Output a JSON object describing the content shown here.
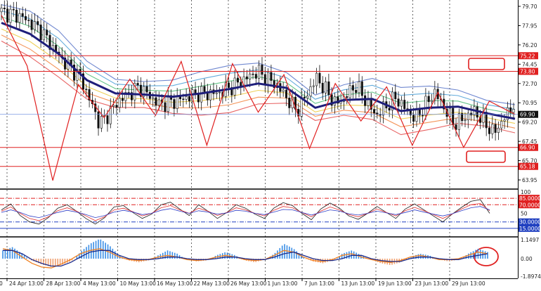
{
  "chart_data": [
    {
      "type": "candlestick",
      "panel": "price",
      "price_ticks": [
        "79.70",
        "77.95",
        "76.20",
        "74.45",
        "72.70",
        "70.95",
        "69.20",
        "67.45",
        "65.70",
        "63.95"
      ],
      "x_labels": [
        "24 Apr 13:00",
        "28 Apr 13:00",
        "4 May 13:00",
        "10 May 13:00",
        "16 May 13:00",
        "22 May 13:00",
        "26 May 13:00",
        "1 Jun 13:00",
        "7 Jun 13:00",
        "13 Jun 13:00",
        "19 Jun 13:00",
        "23 Jun 13:00",
        "29 Jun 13:00"
      ],
      "x_first_label_fragment": "0",
      "current_price": "69.90",
      "current_price_value": 69.9,
      "horizontal_levels": [
        {
          "label": "75.22",
          "value": 75.22,
          "color": "#e02020"
        },
        {
          "label": "73.80",
          "value": 73.8,
          "color": "#e02020"
        },
        {
          "label": "66.90",
          "value": 66.9,
          "color": "#e02020"
        },
        {
          "label": "65.18",
          "value": 65.18,
          "color": "#e02020"
        }
      ],
      "zigzag_points": [
        78.9,
        74.3,
        63.9,
        72.6,
        69.6,
        73.1,
        69.8,
        74.7,
        67.1,
        74.5,
        70.1,
        73.5,
        66.8,
        72.7,
        69.3,
        72.4,
        67.1,
        71.9,
        66.9,
        71.1,
        69.9
      ],
      "moving_average": [
        78.2,
        77.2,
        75.4,
        73.0,
        71.8,
        71.7,
        71.5,
        71.8,
        72.2,
        72.7,
        72.3,
        70.5,
        71.2,
        71.3,
        70.2,
        70.5,
        70.6,
        70.0,
        69.5
      ],
      "price_path": [
        79.2,
        78.8,
        77.5,
        75.0,
        73.3,
        69.0,
        71.2,
        72.4,
        70.8,
        71.2,
        71.8,
        71.8,
        72.7,
        73.8,
        72.5,
        70.2,
        73.2,
        70.8,
        72.5,
        69.8,
        71.4,
        69.5,
        71.9,
        69.0,
        70.2,
        68.2,
        70.8
      ]
    },
    {
      "type": "line",
      "panel": "oscillator",
      "levels": [
        {
          "label": "85.0000",
          "value": 85,
          "color": "#e02020",
          "style": "dashdot"
        },
        {
          "label": "70.0000",
          "value": 70,
          "color": "#e02020",
          "style": "dashdot"
        },
        {
          "label": "30.0000",
          "value": 30,
          "color": "#2040c0",
          "style": "dashdot"
        },
        {
          "label": "15.0000",
          "value": 15,
          "color": "#2040c0",
          "style": "solid"
        }
      ],
      "tick_labels": [
        "100",
        "50"
      ],
      "series": [
        {
          "values": [
            58,
            72,
            45,
            30,
            25,
            40,
            62,
            70,
            55,
            38,
            25,
            40,
            65,
            68,
            52,
            38,
            48,
            70,
            76,
            60,
            45,
            70,
            55,
            38,
            52,
            70,
            62,
            48,
            38,
            62,
            75,
            68,
            50,
            35,
            60,
            74,
            62,
            44,
            36,
            50,
            66,
            52,
            38,
            60,
            72,
            58,
            44,
            30,
            48,
            64,
            78,
            82,
            50
          ],
          "color": "#1a1a1a"
        },
        {
          "values": [
            55,
            65,
            50,
            38,
            33,
            42,
            56,
            63,
            55,
            44,
            33,
            42,
            58,
            62,
            54,
            44,
            50,
            63,
            68,
            58,
            50,
            62,
            55,
            45,
            52,
            63,
            58,
            50,
            44,
            57,
            66,
            63,
            52,
            42,
            55,
            65,
            58,
            47,
            42,
            50,
            60,
            52,
            44,
            56,
            64,
            56,
            47,
            38,
            48,
            60,
            70,
            73,
            56
          ],
          "color": "#e03030"
        },
        {
          "values": [
            52,
            58,
            52,
            44,
            40,
            46,
            52,
            57,
            53,
            47,
            40,
            45,
            53,
            57,
            53,
            47,
            50,
            57,
            61,
            55,
            50,
            56,
            53,
            48,
            51,
            57,
            55,
            50,
            47,
            53,
            59,
            58,
            52,
            46,
            52,
            58,
            55,
            49,
            46,
            50,
            55,
            51,
            47,
            52,
            58,
            53,
            48,
            44,
            49,
            56,
            63,
            66,
            58
          ],
          "color": "#3040c8"
        }
      ]
    },
    {
      "type": "bar",
      "panel": "macd",
      "tick_labels": [
        "1.1497",
        "0.00",
        "-1.8974"
      ],
      "histogram": [
        0.5,
        0.7,
        0.3,
        -0.2,
        -0.6,
        -0.9,
        -0.7,
        -0.3,
        0.4,
        0.9,
        1.2,
        0.8,
        0.2,
        -0.2,
        -0.4,
        -0.2,
        0.2,
        0.5,
        0.3,
        -0.1,
        -0.3,
        -0.2,
        0.2,
        0.4,
        0.2,
        -0.2,
        -0.4,
        -0.1,
        0.3,
        0.9,
        0.6,
        0.1,
        -0.3,
        -0.5,
        -0.2,
        0.3,
        0.5,
        0.2,
        -0.1,
        -0.5,
        -0.7,
        -0.4,
        0.1,
        0.3,
        0.2,
        -0.1,
        -0.3,
        -0.1,
        0.3,
        0.6,
        0.4
      ],
      "lines": [
        {
          "values": [
            0.6,
            0.5,
            0.1,
            -0.5,
            -0.9,
            -1.0,
            -0.6,
            -0.1,
            0.3,
            0.5,
            0.6,
            0.4,
            0.1,
            -0.1,
            -0.2,
            -0.1,
            0.1,
            0.2,
            0.1,
            -0.1,
            -0.2,
            -0.1,
            0.1,
            0.2,
            0.1,
            -0.1,
            -0.2,
            -0.1,
            0.2,
            0.5,
            0.4,
            0.1,
            -0.2,
            -0.3,
            -0.1,
            0.2,
            0.3,
            0.1,
            -0.1,
            -0.3,
            -0.4,
            -0.2,
            0.1,
            0.2,
            0.1,
            -0.1,
            -0.1,
            0.0,
            0.2,
            0.4,
            0.3
          ],
          "color": "#f08020"
        },
        {
          "values": [
            0.5,
            0.5,
            0.3,
            -0.1,
            -0.5,
            -0.8,
            -0.8,
            -0.4,
            0.1,
            0.4,
            0.5,
            0.5,
            0.2,
            0.0,
            -0.1,
            -0.1,
            0.0,
            0.1,
            0.1,
            0.0,
            -0.1,
            -0.1,
            0.0,
            0.1,
            0.1,
            0.0,
            -0.1,
            -0.1,
            0.1,
            0.3,
            0.4,
            0.2,
            0.0,
            -0.2,
            -0.2,
            0.0,
            0.2,
            0.2,
            0.0,
            -0.2,
            -0.3,
            -0.3,
            0.0,
            0.1,
            0.1,
            0.0,
            -0.1,
            -0.1,
            0.1,
            0.2,
            0.3
          ],
          "color": "#1a2a8a"
        }
      ]
    }
  ],
  "colors": {
    "price_line": "#6688dd",
    "levels": "#e02020",
    "ma": "#1e1e7a",
    "zigzag": "#e02020",
    "marker": "#e02020",
    "hist_pos": "#3a8ee6",
    "hist_neg": "#f0a070",
    "current_tag": "#111111"
  }
}
